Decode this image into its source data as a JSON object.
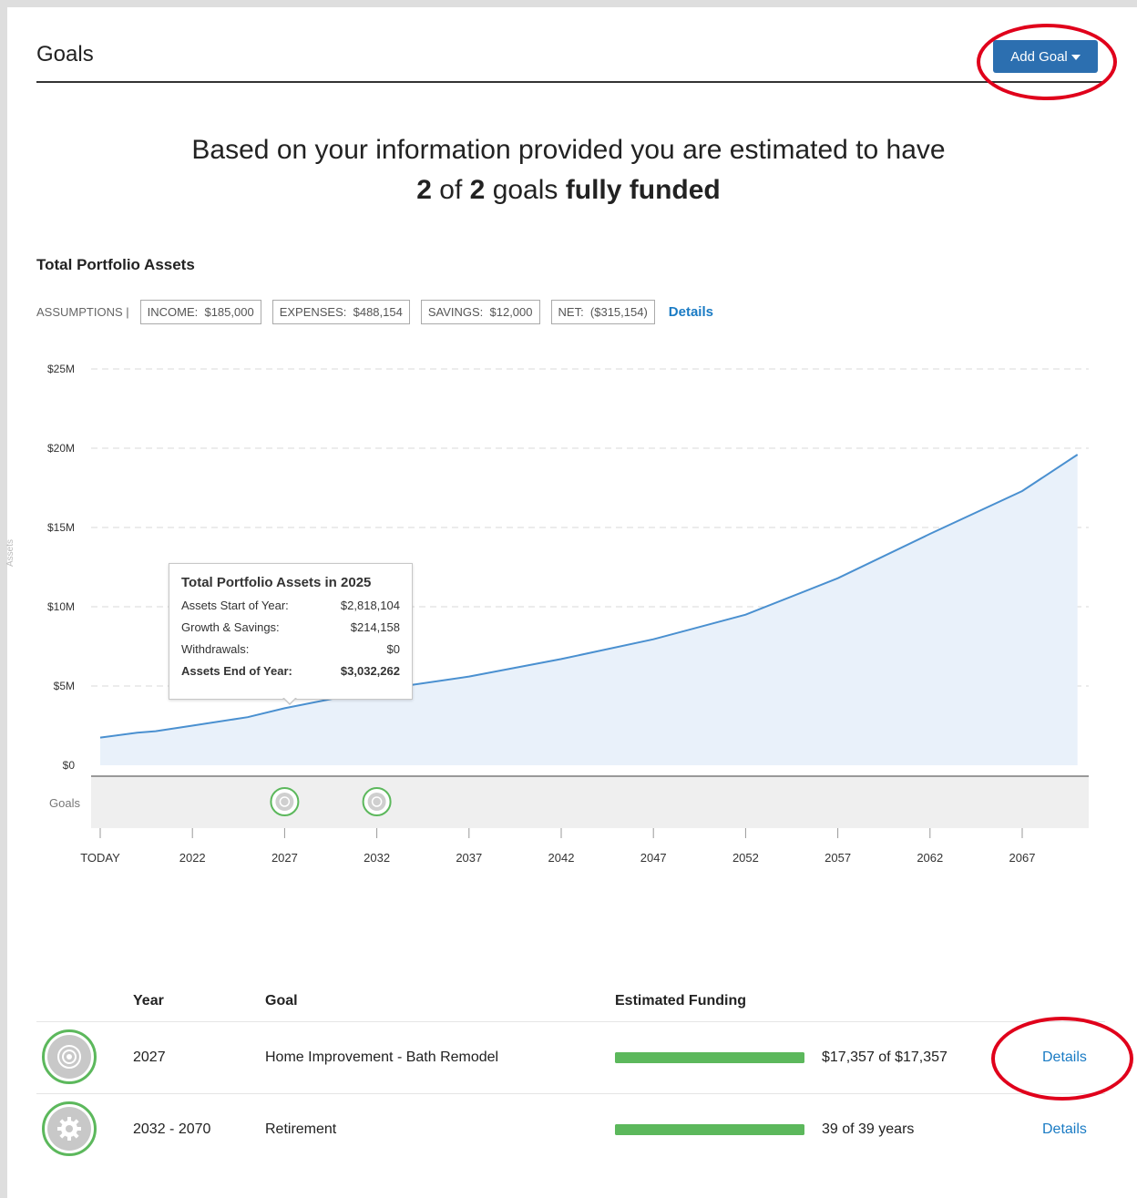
{
  "header": {
    "title": "Goals",
    "add_goal_label": "Add Goal"
  },
  "headline": {
    "line1": "Based on your information provided you are estimated to have",
    "funded": "2",
    "of_word": "of",
    "total": "2",
    "goals_word": "goals",
    "status": "fully funded"
  },
  "chart_section": {
    "title": "Total Portfolio Assets",
    "assumptions_label": "ASSUMPTIONS |",
    "income": "INCOME:  $185,000",
    "expenses": "EXPENSES:  $488,154",
    "savings": "SAVINGS:  $12,000",
    "net": "NET:  ($315,154)",
    "details_label": "Details"
  },
  "chart_data": {
    "type": "area",
    "title": "Total Portfolio Assets",
    "ylabel": "Assets",
    "ylim": [
      0,
      25000000
    ],
    "y_ticks": [
      "$0",
      "$5M",
      "$10M",
      "$15M",
      "$20M",
      "$25M"
    ],
    "x_ticks": [
      "TODAY",
      "2022",
      "2027",
      "2032",
      "2037",
      "2042",
      "2047",
      "2052",
      "2057",
      "2062",
      "2067"
    ],
    "x": [
      2017,
      2019,
      2020,
      2022,
      2025,
      2027,
      2032,
      2037,
      2042,
      2047,
      2052,
      2057,
      2062,
      2067,
      2070
    ],
    "values": [
      1750000,
      2050000,
      2150000,
      2500000,
      3032262,
      3600000,
      4750000,
      5600000,
      6700000,
      7950000,
      9500000,
      11800000,
      14600000,
      17300000,
      19600000
    ],
    "grid": true,
    "goals_row_label": "Goals",
    "goal_markers": [
      2027,
      2032
    ],
    "colors": {
      "line": "#4a90d0",
      "fill": "#e9f1fa",
      "goal_ring": "#5cb85c"
    }
  },
  "tooltip": {
    "title": "Total Portfolio Assets in 2025",
    "rows": [
      {
        "label": "Assets Start of Year:",
        "value": "$2,818,104"
      },
      {
        "label": "Growth & Savings:",
        "value": "$214,158"
      },
      {
        "label": "Withdrawals:",
        "value": "$0"
      },
      {
        "label": "Assets End of Year:",
        "value": "$3,032,262"
      }
    ]
  },
  "goals_table": {
    "headers": {
      "year": "Year",
      "goal": "Goal",
      "funding": "Estimated Funding"
    },
    "rows": [
      {
        "icon": "target-icon",
        "year": "2027",
        "goal": "Home Improvement - Bath Remodel",
        "funding_fraction": 1.0,
        "funding_text": "$17,357 of $17,357",
        "details": "Details"
      },
      {
        "icon": "gear-icon",
        "year": "2032 - 2070",
        "goal": "Retirement",
        "funding_fraction": 1.0,
        "funding_text": "39 of 39 years",
        "details": "Details"
      }
    ]
  }
}
